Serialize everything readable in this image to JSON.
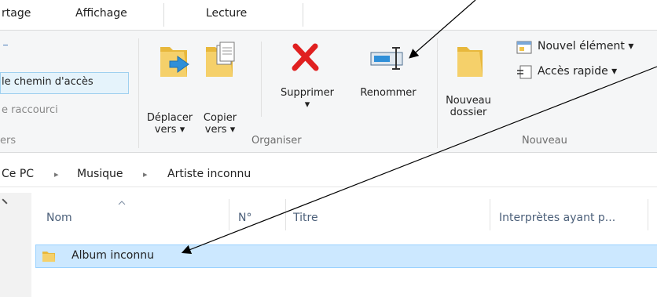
{
  "tabs": [
    "rtage",
    "Affichage",
    "Lecture"
  ],
  "ribbon": {
    "left_items": [
      "le chemin d'accès",
      "e raccourci",
      "ers"
    ],
    "organiser": {
      "group_label": "Organiser",
      "deplacer": [
        "Déplacer",
        "vers ▾"
      ],
      "copier": [
        "Copier",
        "vers ▾"
      ],
      "supprimer": [
        "Supprimer",
        "▾"
      ],
      "renommer": "Renommer"
    },
    "nouveau": {
      "group_label": "Nouveau",
      "dossier": [
        "Nouveau",
        "dossier"
      ],
      "nouvel_element": "Nouvel élément ▾",
      "acces_rapide": "Accès rapide ▾"
    }
  },
  "address": {
    "parts": [
      "Ce PC",
      "Musique",
      "Artiste inconnu"
    ],
    "separator": "▸"
  },
  "columns": [
    "Nom",
    "N°",
    "Titre",
    "Interprètes ayant p..."
  ],
  "rows": [
    {
      "name": "Album inconnu"
    }
  ],
  "colors": {
    "selection": "#cce8ff",
    "highlight": "#e5f3fb",
    "delete_red": "#e02020",
    "folder": "#f0c44c"
  }
}
